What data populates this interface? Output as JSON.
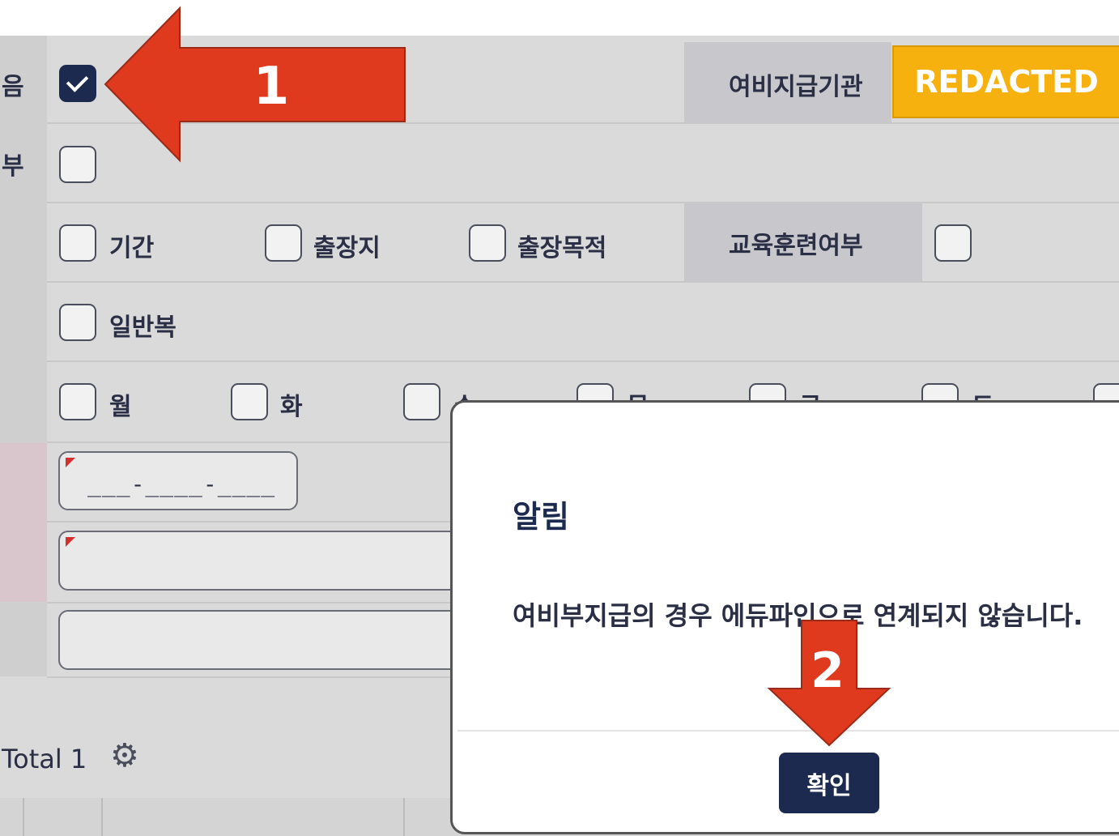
{
  "form": {
    "row1": {
      "label_fragment": "음",
      "checked": true,
      "payer_label": "여비지급기관",
      "payer_value": "REDACTED"
    },
    "row2": {
      "label_fragment": "부"
    },
    "row3": {
      "options": [
        "기간",
        "출장지",
        "출장목적"
      ],
      "education_label": "교육훈련여부"
    },
    "row4": {
      "options": [
        "일반복"
      ]
    },
    "row5": {
      "options": [
        "월",
        "화",
        "수",
        "목",
        "금",
        "토"
      ]
    },
    "date_mask": "___-____-____",
    "total_label": "Total 1"
  },
  "dialog": {
    "title": "알림",
    "message": "여비부지급의 경우 에듀파인으로 연계되지 않습니다.",
    "ok_label": "확인"
  },
  "annotations": {
    "arrow1_number": "1",
    "arrow2_number": "2",
    "arrow_color": "#e03a1e"
  },
  "colors": {
    "primary_navy": "#1d2a4f",
    "redacted_bg": "#f7b10f",
    "form_bg": "#dadada"
  },
  "icons": {
    "settings": "gear-icon",
    "check": "check-icon"
  }
}
